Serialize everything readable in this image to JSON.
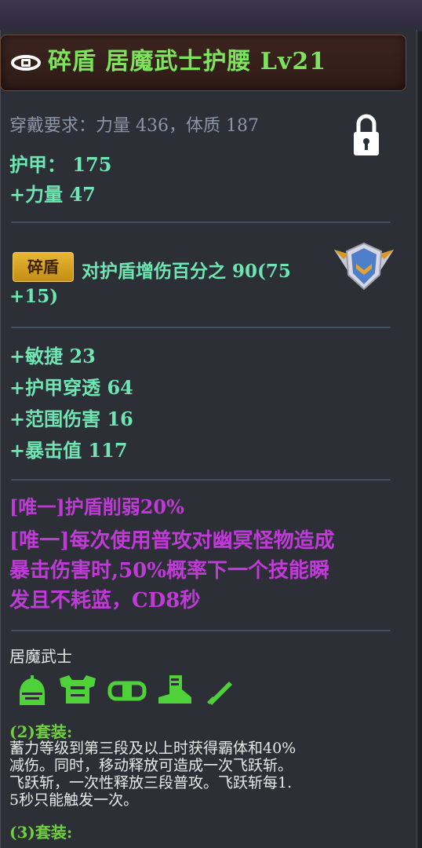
{
  "item": {
    "title": "碎盾 居魔武士护腰 Lv21",
    "requirement": "穿戴要求：力量 436，体质 187",
    "base_stats": [
      "护甲：  175",
      "+力量 47"
    ],
    "affix": {
      "badge": "碎盾",
      "text_line1": "对护盾增伤百分之 90(75",
      "text_line2": "+15)"
    },
    "extra_stats": [
      "+敏捷 23",
      "+护甲穿透 64",
      "+范围伤害 16",
      "+暴击值 117"
    ],
    "unique_lines": [
      "[唯一]护盾削弱20%",
      "[唯一]每次使用普攻对幽冥怪物造成",
      "暴击伤害时,50%概率下一个技能瞬",
      "发且不耗蓝，CD8秒"
    ],
    "set": {
      "name": "居魔武士",
      "piece_icons": [
        "helmet-icon",
        "armor-icon",
        "belt-icon",
        "boots-icon",
        "sword-icon"
      ],
      "bonus2_header": "(2)套装:",
      "bonus2_lines": [
        "蓄力等级到第三段及以上时获得霸体和40%",
        "减伤。同时，移动释放可造成一次飞跃斩。",
        "飞跃斩，一次性释放三段普攻。飞跃斩每1.",
        "5秒只能触发一次。"
      ],
      "bonus3_header": "(3)套装:"
    }
  },
  "colors": {
    "title": "#7ee25c",
    "stat": "#6ee5b2",
    "unique": "#c03ad8",
    "set_header": "#6ed03c",
    "badge": "#e8b735"
  }
}
